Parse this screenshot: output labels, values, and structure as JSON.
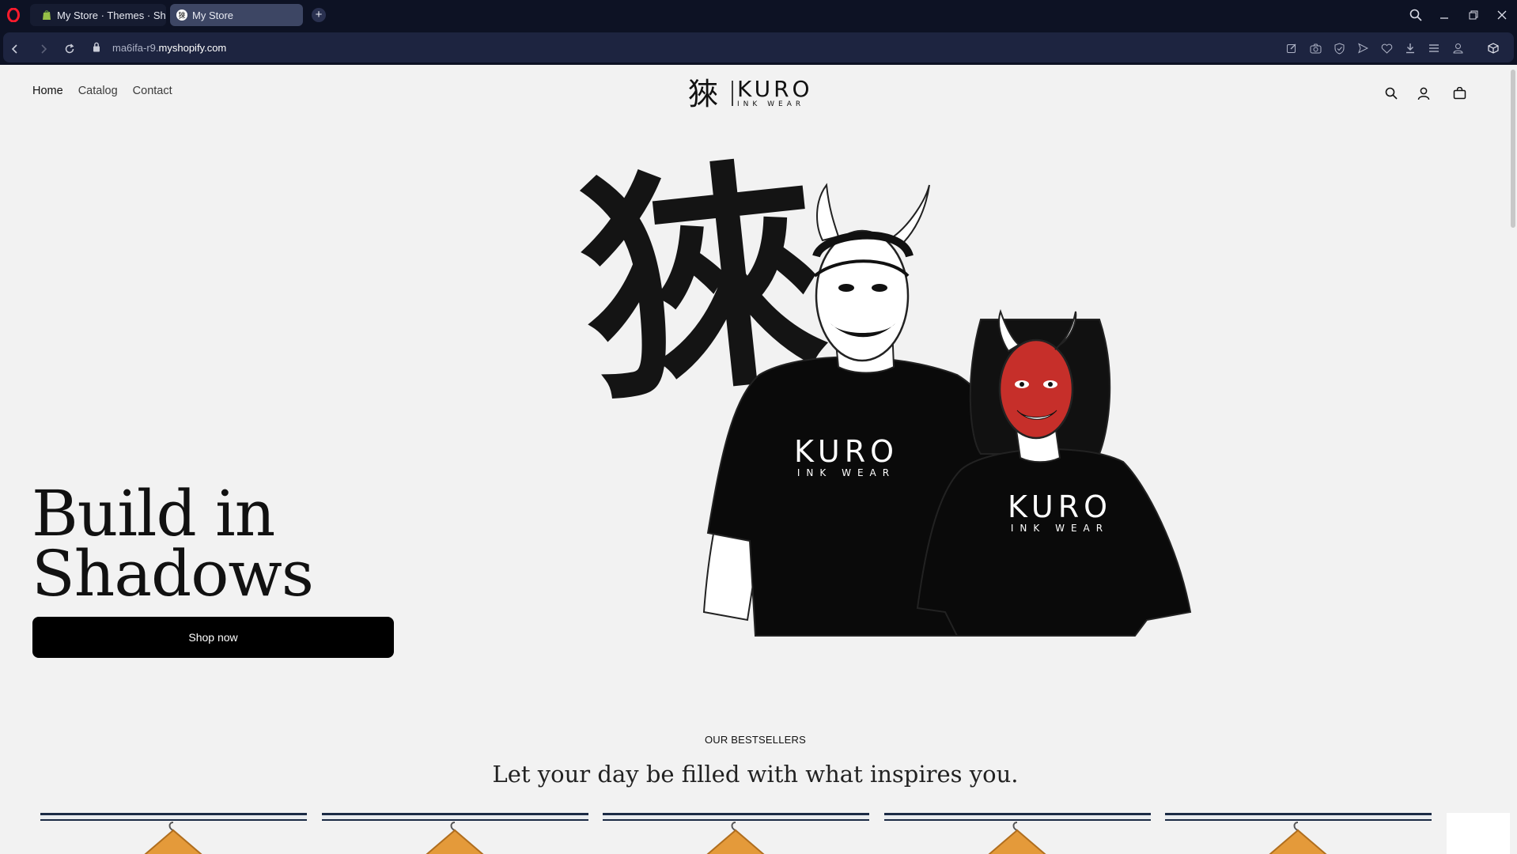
{
  "browser": {
    "tabs": [
      {
        "title": "My Store · Themes · Shopi",
        "active": false
      },
      {
        "title": "My Store",
        "active": true
      }
    ],
    "url_prefix": "ma6ifa-r9.",
    "url_domain": "myshopify.com",
    "accent_color": "#6b3cff"
  },
  "site": {
    "nav": {
      "home": "Home",
      "catalog": "Catalog",
      "contact": "Contact"
    },
    "logo": {
      "kanji": "猍",
      "name": "KURO",
      "tagline": "INK WEAR"
    },
    "header_icons": [
      "search-icon",
      "account-icon",
      "cart-icon"
    ]
  },
  "hero": {
    "title_line1": "Build in",
    "title_line2": "Shadows",
    "button_label": "Shop now",
    "shirt_brand": "KURO",
    "shirt_tagline": "INK WEAR",
    "kanji": "猍"
  },
  "bestsellers": {
    "kicker": "OUR BESTSELLERS",
    "title": "Let your day be filled with what inspires you.",
    "product_count": 5
  }
}
